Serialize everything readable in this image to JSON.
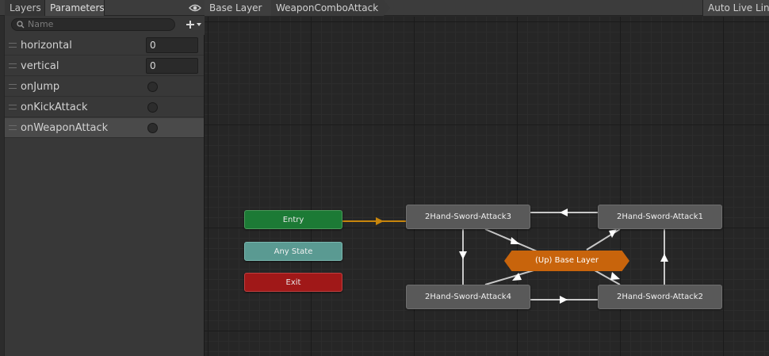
{
  "left_panel": {
    "tabs": {
      "layers": "Layers",
      "parameters": "Parameters"
    },
    "search": {
      "placeholder": "Name"
    },
    "add_button": "+▾",
    "parameters": [
      {
        "name": "horizontal",
        "type": "float",
        "value": "0"
      },
      {
        "name": "vertical",
        "type": "float",
        "value": "0"
      },
      {
        "name": "onJump",
        "type": "trigger"
      },
      {
        "name": "onKickAttack",
        "type": "trigger"
      },
      {
        "name": "onWeaponAttack",
        "type": "trigger",
        "selected": true
      }
    ]
  },
  "breadcrumb": {
    "items": [
      "Base Layer",
      "WeaponComboAttack"
    ]
  },
  "toolbar": {
    "auto_live_link": "Auto Live Link"
  },
  "graph": {
    "nodes": {
      "entry": "Entry",
      "any_state": "Any State",
      "exit": "Exit",
      "attack1": "2Hand-Sword-Attack1",
      "attack2": "2Hand-Sword-Attack2",
      "attack3": "2Hand-Sword-Attack3",
      "attack4": "2Hand-Sword-Attack4",
      "up_base_layer": "(Up) Base Layer"
    }
  },
  "colors": {
    "entry": "#1c7a35",
    "any_state": "#5a9a92",
    "exit": "#a01818",
    "state": "#595959",
    "up_state": "#c8640c",
    "default_transition": "#c8860c",
    "transition": "#c8c8c8"
  }
}
